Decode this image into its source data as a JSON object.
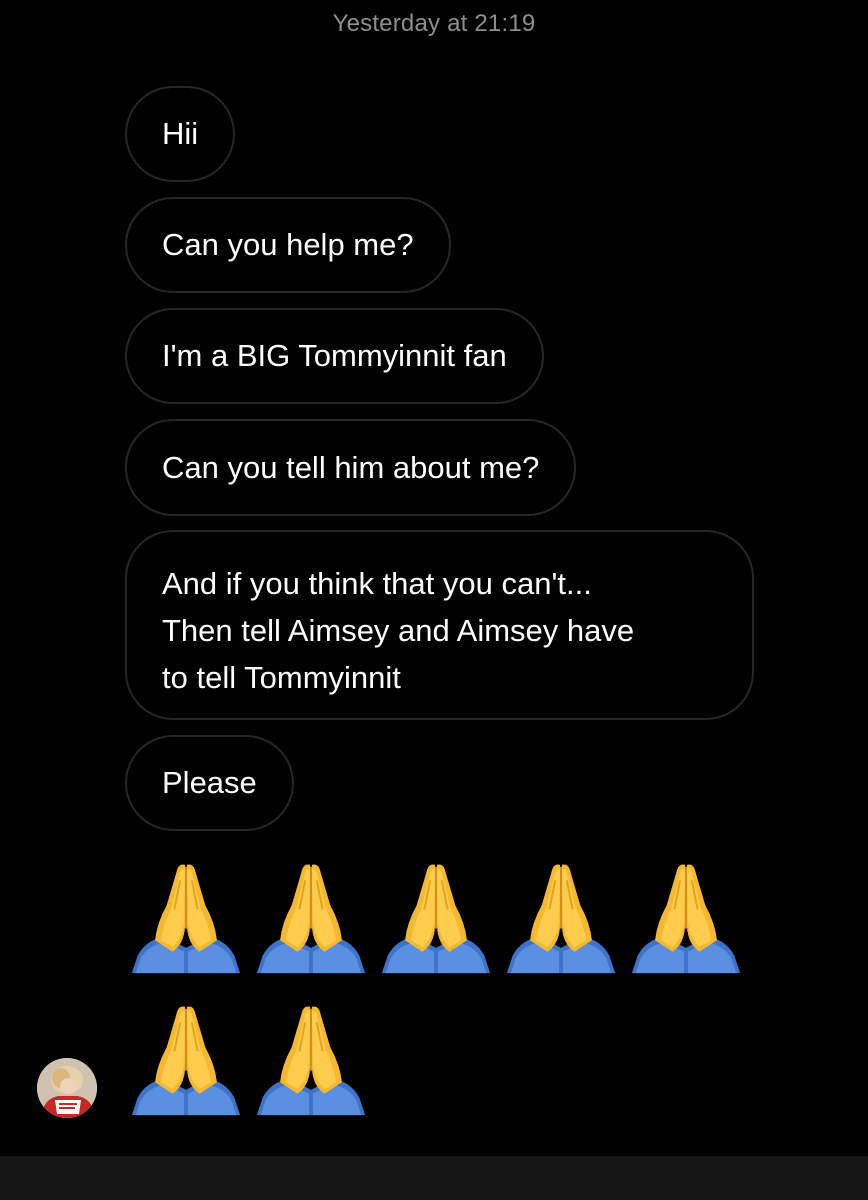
{
  "header": {
    "timestamp": "Yesterday at 21:19"
  },
  "messages": [
    {
      "text": "Hii"
    },
    {
      "text": "Can you help me?"
    },
    {
      "text": "I'm a BIG Tommyinnit fan"
    },
    {
      "text": "Can you tell him about me?"
    },
    {
      "lines": [
        "And if you think that you can't...",
        "Then tell Aimsey and Aimsey have",
        "to tell Tommyinnit"
      ]
    },
    {
      "text": "Please"
    }
  ],
  "emoji_message": {
    "icon": "folded-hands-icon",
    "count": 7
  },
  "sender": {
    "avatar_icon": "user-avatar"
  },
  "colors": {
    "background": "#000000",
    "bubble_border": "#262626",
    "timestamp": "#8e8e8e",
    "text": "#ffffff",
    "bottom_bar": "#161616"
  }
}
